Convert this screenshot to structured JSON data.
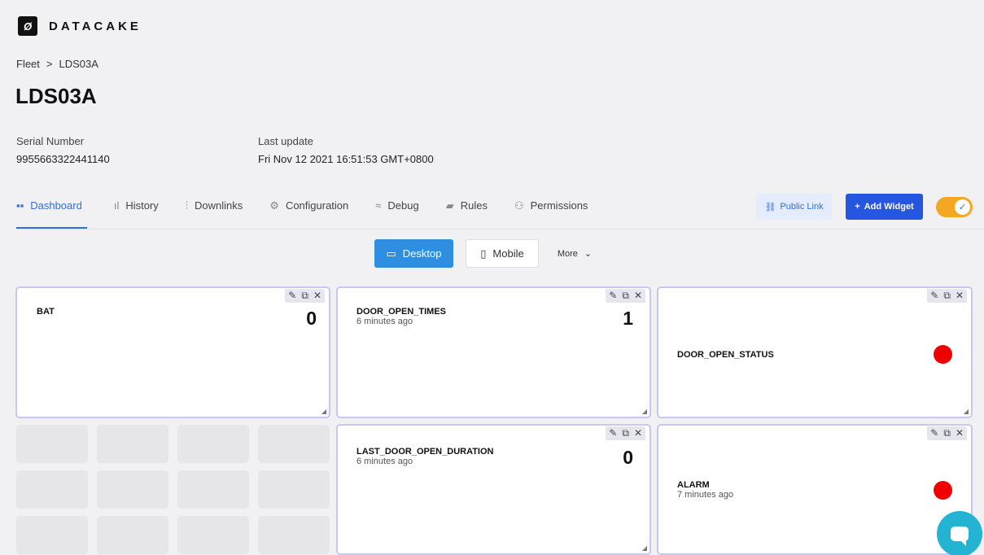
{
  "brand": {
    "logo_glyph": "Ø",
    "name": "DATACAKE"
  },
  "breadcrumb": {
    "root": "Fleet",
    "separator": ">",
    "current": "LDS03A"
  },
  "page_title": "LDS03A",
  "meta": {
    "serial_label": "Serial Number",
    "serial_value": "9955663322441140",
    "update_label": "Last update",
    "update_value": "Fri Nov 12 2021 16:51:53 GMT+0800"
  },
  "tabs": [
    {
      "label": "Dashboard",
      "icon": "grid-icon",
      "glyph": "▪▪",
      "active": true
    },
    {
      "label": "History",
      "icon": "bar-chart-icon",
      "glyph": "ıl",
      "active": false
    },
    {
      "label": "Downlinks",
      "icon": "sliders-icon",
      "glyph": "⫶",
      "active": false
    },
    {
      "label": "Configuration",
      "icon": "gear-icon",
      "glyph": "⚙",
      "active": false
    },
    {
      "label": "Debug",
      "icon": "rss-icon",
      "glyph": "≈",
      "active": false
    },
    {
      "label": "Rules",
      "icon": "chat-icon",
      "glyph": "▰",
      "active": false
    },
    {
      "label": "Permissions",
      "icon": "users-icon",
      "glyph": "⚇",
      "active": false
    }
  ],
  "actions": {
    "public_link": "Public Link",
    "public_link_glyph": "⛓",
    "add_widget": "Add Widget",
    "add_widget_glyph": "+",
    "toggle_on": true,
    "toggle_glyph": "✓"
  },
  "view": {
    "desktop": "Desktop",
    "desktop_glyph": "▭",
    "mobile": "Mobile",
    "mobile_glyph": "▯",
    "more": "More",
    "more_glyph": "⌄"
  },
  "widget_tools": {
    "edit": "✎",
    "copy": "⧉",
    "close": "✕"
  },
  "widgets": {
    "bat": {
      "name": "BAT",
      "value": "0"
    },
    "door_open_times": {
      "name": "DOOR_OPEN_TIMES",
      "sub": "6 minutes ago",
      "value": "1"
    },
    "door_open_status": {
      "name": "DOOR_OPEN_STATUS",
      "status_color": "#f00000"
    },
    "last_door_open_duration": {
      "name": "LAST_DOOR_OPEN_DURATION",
      "sub": "6 minutes ago",
      "value": "0"
    },
    "alarm": {
      "name": "ALARM",
      "sub": "7 minutes ago",
      "status_color": "#f00000"
    }
  },
  "colors": {
    "accent": "#2f6fde",
    "add_button": "#2456e0",
    "desktop_button": "#2f8edf",
    "toggle": "#f5a623",
    "chat": "#23b4d3",
    "widget_border": "#c8c8ee"
  }
}
